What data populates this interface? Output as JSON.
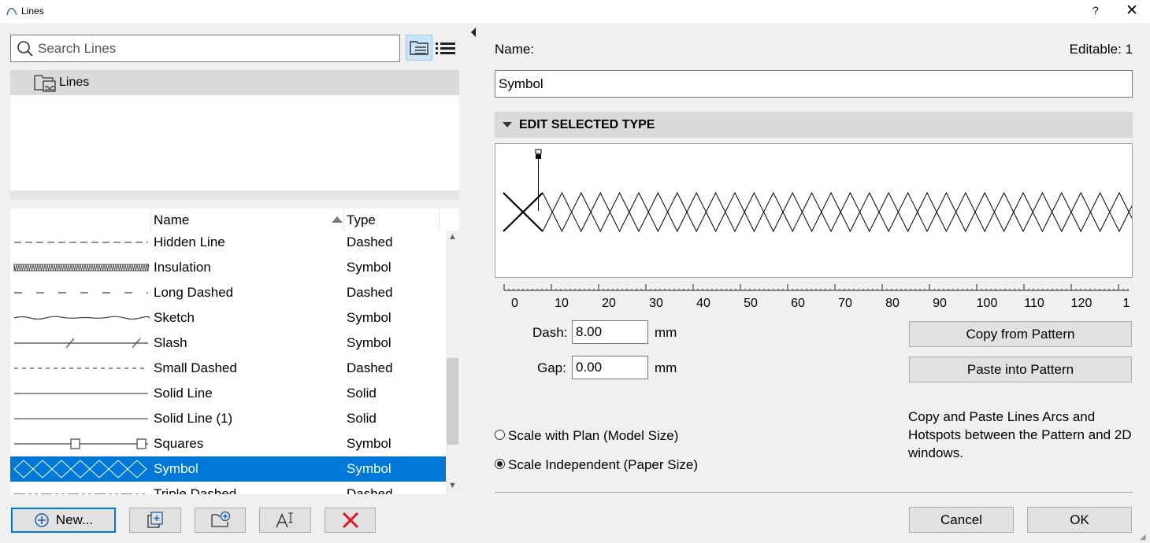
{
  "window": {
    "title": "Lines",
    "help_label": "?",
    "close_label": "✕"
  },
  "search": {
    "placeholder": "Search Lines"
  },
  "folder": {
    "label": "Lines"
  },
  "list": {
    "header_name": "Name",
    "header_type": "Type",
    "rows": [
      {
        "name": "Hidden Line",
        "type": "Dashed",
        "preview": "hidden"
      },
      {
        "name": "Insulation",
        "type": "Symbol",
        "preview": "insulation"
      },
      {
        "name": "Long Dashed",
        "type": "Dashed",
        "preview": "long-dashed"
      },
      {
        "name": "Sketch",
        "type": "Symbol",
        "preview": "sketch"
      },
      {
        "name": "Slash",
        "type": "Symbol",
        "preview": "slash"
      },
      {
        "name": "Small Dashed",
        "type": "Dashed",
        "preview": "small-dashed"
      },
      {
        "name": "Solid Line",
        "type": "Solid",
        "preview": "solid"
      },
      {
        "name": "Solid Line (1)",
        "type": "Solid",
        "preview": "solid"
      },
      {
        "name": "Squares",
        "type": "Symbol",
        "preview": "squares"
      },
      {
        "name": "Symbol",
        "type": "Symbol",
        "preview": "symbol",
        "selected": true
      },
      {
        "name": "Triple Dashed",
        "type": "Dashed",
        "preview": "triple-dashed"
      }
    ]
  },
  "buttons": {
    "new_label": "New...",
    "copy_from_pattern": "Copy from Pattern",
    "paste_into_pattern": "Paste into Pattern",
    "cancel": "Cancel",
    "ok": "OK"
  },
  "details": {
    "name_label": "Name:",
    "editable_label": "Editable: 1",
    "name_value": "Symbol",
    "section_title": "EDIT SELECTED TYPE",
    "dash_label": "Dash:",
    "dash_value": "8.00",
    "dash_unit": "mm",
    "gap_label": "Gap:",
    "gap_value": "0.00",
    "gap_unit": "mm",
    "ruler_labels": [
      "0",
      "10",
      "20",
      "30",
      "40",
      "50",
      "60",
      "70",
      "80",
      "90",
      "100",
      "110",
      "120",
      "1"
    ],
    "hint": "Copy and Paste Lines Arcs and Hotspots between the Pattern and 2D windows.",
    "scale_plan_label": "Scale with Plan (Model Size)",
    "scale_paper_label": "Scale Independent (Paper Size)",
    "scale_selected": "paper"
  },
  "colors": {
    "selection": "#0078d7",
    "delete_icon": "#e81123",
    "accent_border": "#0078d7"
  },
  "icons": [
    "app-icon",
    "search-icon",
    "tree-view-icon",
    "list-view-icon",
    "folder-icon",
    "sort-asc-icon",
    "plus-circle-icon",
    "duplicate-icon",
    "new-folder-icon",
    "rename-icon",
    "delete-icon",
    "collapse-triangle-icon",
    "splitter-arrow-icon"
  ]
}
